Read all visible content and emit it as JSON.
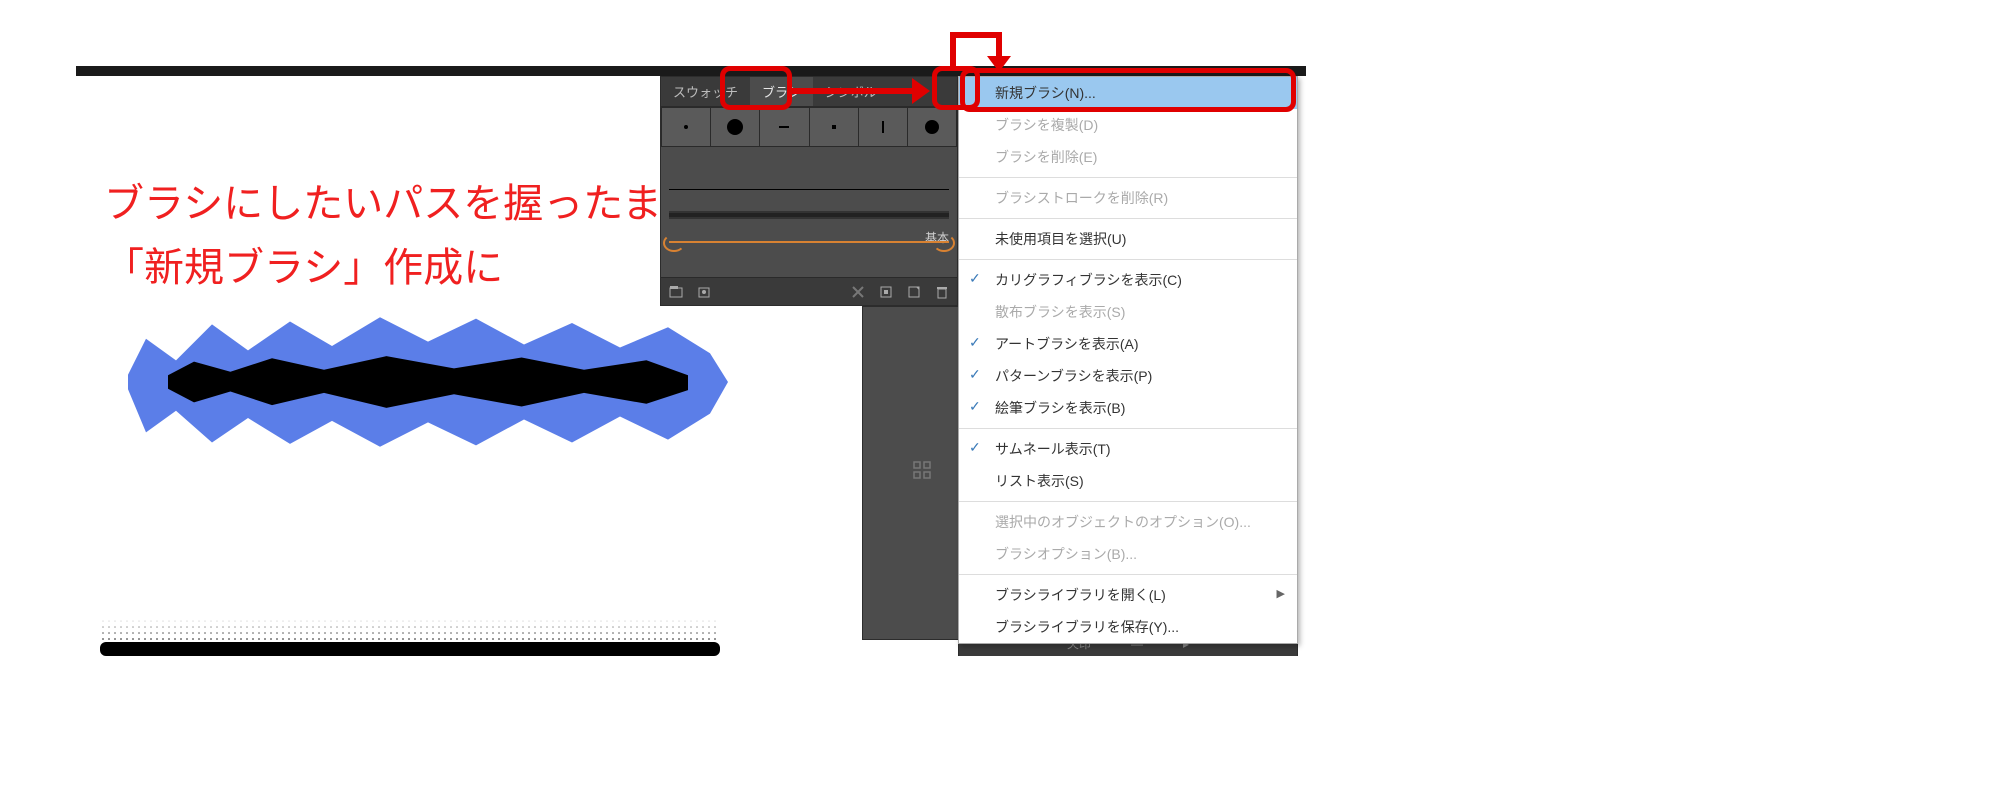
{
  "annotation": {
    "line1": "ブラシにしたいパスを握ったまま",
    "line2": "「新規ブラシ」作成に"
  },
  "panel": {
    "tabs": {
      "swatch": "スウォッチ",
      "brush": "ブラシ",
      "symbol": "シンボル"
    },
    "basic_label": "基本"
  },
  "panel_footer": {
    "library_icon": "library-icon",
    "libraries_icon": "libraries-panel-icon",
    "remove_stroke_icon": "remove-stroke-icon",
    "options_icon": "options-icon",
    "new_icon": "new-brush-icon",
    "trash_icon": "trash-icon"
  },
  "bottom_strip": {
    "label": "矢印",
    "dash": "—"
  },
  "menu": {
    "new_brush": "新規ブラシ(N)...",
    "duplicate": "ブラシを複製(D)",
    "delete": "ブラシを削除(E)",
    "remove_stroke": "ブラシストロークを削除(R)",
    "select_unused": "未使用項目を選択(U)",
    "show_calligraphic": "カリグラフィブラシを表示(C)",
    "show_scatter": "散布ブラシを表示(S)",
    "show_art": "アートブラシを表示(A)",
    "show_pattern": "パターンブラシを表示(P)",
    "show_bristle": "絵筆ブラシを表示(B)",
    "thumbnail_view": "サムネール表示(T)",
    "list_view": "リスト表示(S)",
    "options_of_selection": "選択中のオブジェクトのオプション(O)...",
    "brush_options": "ブラシオプション(B)...",
    "open_library": "ブラシライブラリを開く(L)",
    "save_library": "ブラシライブラリを保存(Y)..."
  }
}
